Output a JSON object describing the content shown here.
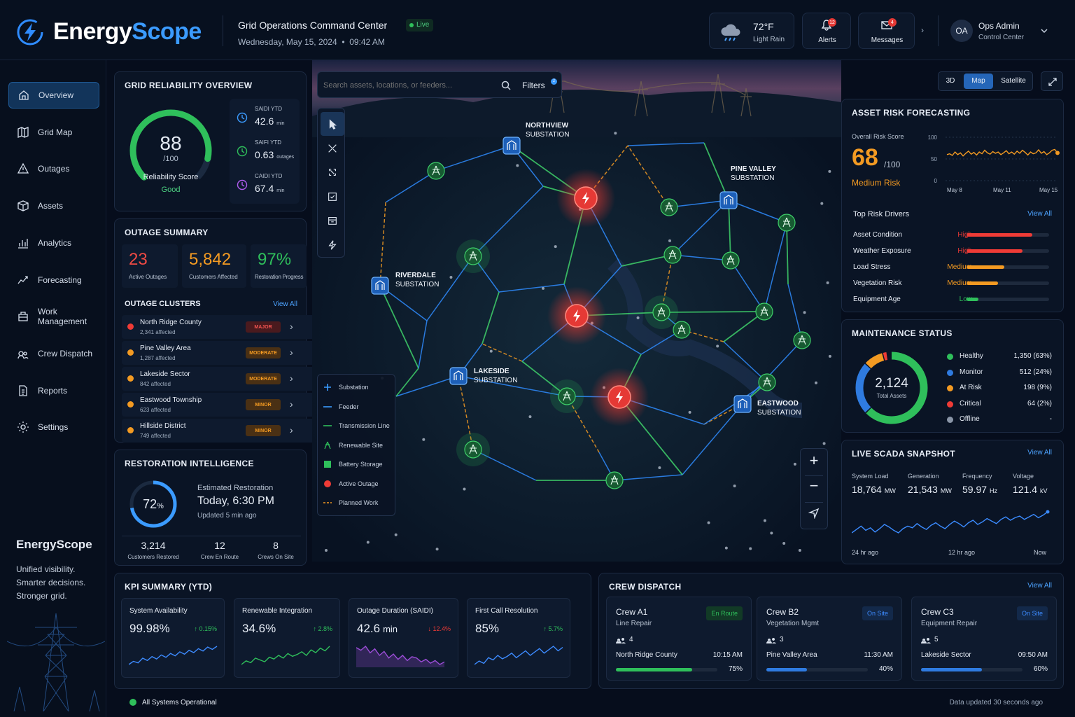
{
  "app": {
    "brand": "EnergyScope",
    "title": "Grid Operations Command Center",
    "live": "Live",
    "date": "Wednesday, May 15, 2024",
    "time": "09:42 AM"
  },
  "weather": {
    "temp": "72°F",
    "cond": "Light Rain"
  },
  "alerts": {
    "label": "Alerts",
    "count": "12"
  },
  "messages": {
    "label": "Messages",
    "count": "4"
  },
  "user": {
    "initials": "OA",
    "name": "Ops Admin",
    "role": "Control Center"
  },
  "nav": [
    "Overview",
    "Grid Map",
    "Outages",
    "Assets",
    "Analytics",
    "Forecasting",
    "Work Management",
    "Crew Dispatch",
    "Reports",
    "Settings"
  ],
  "promo": {
    "brand": "EnergyScope",
    "l1": "Unified visibility.",
    "l2": "Smarter decisions.",
    "l3": "Stronger grid."
  },
  "reliability": {
    "title": "GRID RELIABILITY OVERVIEW",
    "score": "88",
    "max": "/100",
    "label": "Reliability Score",
    "status": "Good",
    "score_value": 88,
    "metrics": [
      {
        "name": "SAIDI YTD",
        "value": "42.6",
        "unit": "min"
      },
      {
        "name": "SAIFI YTD",
        "value": "0.63",
        "unit": "outages"
      },
      {
        "name": "CAIDI YTD",
        "value": "67.4",
        "unit": "min"
      }
    ]
  },
  "outage": {
    "title": "OUTAGE SUMMARY",
    "active": "23",
    "active_label": "Active Outages",
    "customers": "5,842",
    "customers_label": "Customers Affected",
    "restoration": "97%",
    "restoration_label": "Restoration Progress",
    "clusters_title": "OUTAGE CLUSTERS",
    "view_all": "View All",
    "clusters": [
      {
        "name": "North Ridge County",
        "affected": "2,341 affected",
        "sev": "MAJOR"
      },
      {
        "name": "Pine Valley Area",
        "affected": "1,287 affected",
        "sev": "MODERATE"
      },
      {
        "name": "Lakeside Sector",
        "affected": "842 affected",
        "sev": "MODERATE"
      },
      {
        "name": "Eastwood Township",
        "affected": "623 affected",
        "sev": "MINOR"
      },
      {
        "name": "Hillside District",
        "affected": "749 affected",
        "sev": "MINOR"
      }
    ]
  },
  "restoration": {
    "title": "RESTORATION INTELLIGENCE",
    "pct": "72",
    "pct_sym": "%",
    "pct_value": 72,
    "est_label": "Estimated Restoration",
    "est": "Today, 6:30 PM",
    "updated": "Updated 5 min ago",
    "stats": [
      {
        "v": "3,214",
        "l": "Customers Restored"
      },
      {
        "v": "12",
        "l": "Crew En Route"
      },
      {
        "v": "8",
        "l": "Crews On Site"
      }
    ]
  },
  "map": {
    "search_placeholder": "Search assets, locations, or feeders...",
    "filters": "Filters",
    "filters_count": "2",
    "modes": [
      "3D",
      "Map",
      "Satellite"
    ],
    "labels": [
      {
        "l1": "NORTHVIEW",
        "l2": "SUBSTATION"
      },
      {
        "l1": "PINE VALLEY",
        "l2": "SUBSTATION"
      },
      {
        "l1": "RIVERDALE",
        "l2": "SUBSTATION"
      },
      {
        "l1": "LAKESIDE",
        "l2": "SUBSTATION"
      },
      {
        "l1": "EASTWOOD",
        "l2": "SUBSTATION"
      }
    ],
    "legend": [
      "Substation",
      "Feeder",
      "Transmission Line",
      "Renewable Site",
      "Battery Storage",
      "Active Outage",
      "Planned Work"
    ]
  },
  "risk": {
    "title": "ASSET RISK FORECASTING",
    "overall": "Overall Risk Score",
    "score": "68",
    "max": "/100",
    "level": "Medium Risk",
    "chart": {
      "type": "line",
      "y_ticks": [
        "100",
        "50",
        "0"
      ],
      "x_ticks": [
        "May 8",
        "May 11",
        "May 15"
      ],
      "values": [
        60,
        62,
        58,
        66,
        60,
        64,
        57,
        63,
        68,
        61,
        65,
        59,
        66,
        62,
        70,
        64,
        61,
        67,
        63,
        66,
        60,
        64,
        69,
        62,
        66,
        61,
        68,
        63,
        70,
        65,
        59,
        66,
        62,
        64,
        71,
        63,
        67,
        60,
        64,
        70,
        72,
        64
      ]
    },
    "drivers_title": "Top Risk Drivers",
    "view_all": "View All",
    "drivers": [
      {
        "name": "Asset Condition",
        "level": "High",
        "pct": 0.8,
        "color": "#ef3b36"
      },
      {
        "name": "Weather Exposure",
        "level": "High",
        "pct": 0.68,
        "color": "#ef3b36"
      },
      {
        "name": "Load Stress",
        "level": "Medium",
        "pct": 0.46,
        "color": "#f39a22"
      },
      {
        "name": "Vegetation Risk",
        "level": "Medium",
        "pct": 0.38,
        "color": "#f39a22"
      },
      {
        "name": "Equipment Age",
        "level": "Low",
        "pct": 0.14,
        "color": "#2fbf5b"
      }
    ]
  },
  "maintenance": {
    "title": "MAINTENANCE STATUS",
    "total": "2,124",
    "total_label": "Total Assets",
    "items": [
      {
        "name": "Healthy",
        "val": "1,350 (63%)",
        "color": "#2fbf5b",
        "pct": 63
      },
      {
        "name": "Monitor",
        "val": "512 (24%)",
        "color": "#2f7be0",
        "pct": 24
      },
      {
        "name": "At Risk",
        "val": "198 (9%)",
        "color": "#f39a22",
        "pct": 9
      },
      {
        "name": "Critical",
        "val": "64 (2%)",
        "color": "#ef3b36",
        "pct": 2
      },
      {
        "name": "Offline",
        "val": "-",
        "color": "#8a96a8",
        "pct": 0
      }
    ]
  },
  "scada": {
    "title": "LIVE SCADA SNAPSHOT",
    "view_all": "View All",
    "metrics": [
      {
        "n": "System Load",
        "v": "18,764",
        "u": "MW"
      },
      {
        "n": "Generation",
        "v": "21,543",
        "u": "MW"
      },
      {
        "n": "Frequency",
        "v": "59.97",
        "u": "Hz"
      },
      {
        "n": "Voltage",
        "v": "121.4",
        "u": "kV"
      }
    ],
    "x_ticks": [
      "24 hr ago",
      "12 hr ago",
      "Now"
    ],
    "chart": {
      "type": "line",
      "values": [
        30,
        34,
        38,
        33,
        36,
        31,
        35,
        40,
        37,
        33,
        30,
        35,
        38,
        36,
        41,
        37,
        34,
        39,
        42,
        38,
        35,
        40,
        44,
        41,
        37,
        42,
        45,
        40,
        43,
        47,
        44,
        41,
        46,
        49,
        45,
        48,
        50,
        46,
        49,
        52,
        48,
        51,
        55
      ]
    }
  },
  "kpi": {
    "title": "KPI SUMMARY (YTD)",
    "cards": [
      {
        "n": "System Availability",
        "v": "99.98%",
        "d": "↑ 0.15%",
        "dc": "#2fbf5b",
        "c": "#3d8bff",
        "vals": [
          10,
          14,
          12,
          18,
          15,
          20,
          17,
          22,
          19,
          24,
          21,
          26,
          23,
          28,
          25,
          30,
          27,
          32,
          29,
          33
        ]
      },
      {
        "n": "Renewable Integration",
        "v": "34.6%",
        "d": "↑ 2.8%",
        "dc": "#2fbf5b",
        "c": "#2fbf5b",
        "vals": [
          8,
          12,
          10,
          15,
          13,
          11,
          16,
          14,
          18,
          15,
          20,
          17,
          19,
          22,
          18,
          24,
          21,
          26,
          23,
          28
        ]
      },
      {
        "n": "Outage Duration (SAIDI)",
        "v": "42.6",
        "vu": "min",
        "d": "↓ 12.4%",
        "dc": "#ef3b36",
        "c": "#9b4dd6",
        "vals": [
          28,
          26,
          29,
          24,
          27,
          22,
          25,
          20,
          23,
          19,
          22,
          18,
          21,
          20,
          17,
          19,
          16,
          18,
          15,
          17
        ]
      },
      {
        "n": "First Call Resolution",
        "v": "85%",
        "d": "↑ 5.7%",
        "dc": "#2fbf5b",
        "c": "#3d8bff",
        "vals": [
          10,
          13,
          11,
          16,
          14,
          18,
          15,
          17,
          20,
          16,
          19,
          22,
          18,
          21,
          24,
          20,
          23,
          26,
          22,
          25
        ]
      }
    ]
  },
  "crew": {
    "title": "CREW DISPATCH",
    "view_all": "View All",
    "items": [
      {
        "name": "Crew A1",
        "type": "Line Repair",
        "status": "En Route",
        "sc": "#2fbf5b",
        "count": "4",
        "loc": "North Ridge County",
        "time": "10:15 AM",
        "pct": "75%",
        "pv": 0.75,
        "bc": "#2fbf5b"
      },
      {
        "name": "Crew B2",
        "type": "Vegetation Mgmt",
        "status": "On Site",
        "sc": "#3d8bff",
        "count": "3",
        "loc": "Pine Valley Area",
        "time": "11:30 AM",
        "pct": "40%",
        "pv": 0.4,
        "bc": "#2f7be0"
      },
      {
        "name": "Crew C3",
        "type": "Equipment Repair",
        "status": "On Site",
        "sc": "#3d8bff",
        "count": "5",
        "loc": "Lakeside Sector",
        "time": "09:50 AM",
        "pct": "60%",
        "pv": 0.6,
        "bc": "#2f7be0"
      }
    ]
  },
  "footer": {
    "status": "All Systems Operational",
    "updated": "Data updated 30 seconds ago"
  }
}
